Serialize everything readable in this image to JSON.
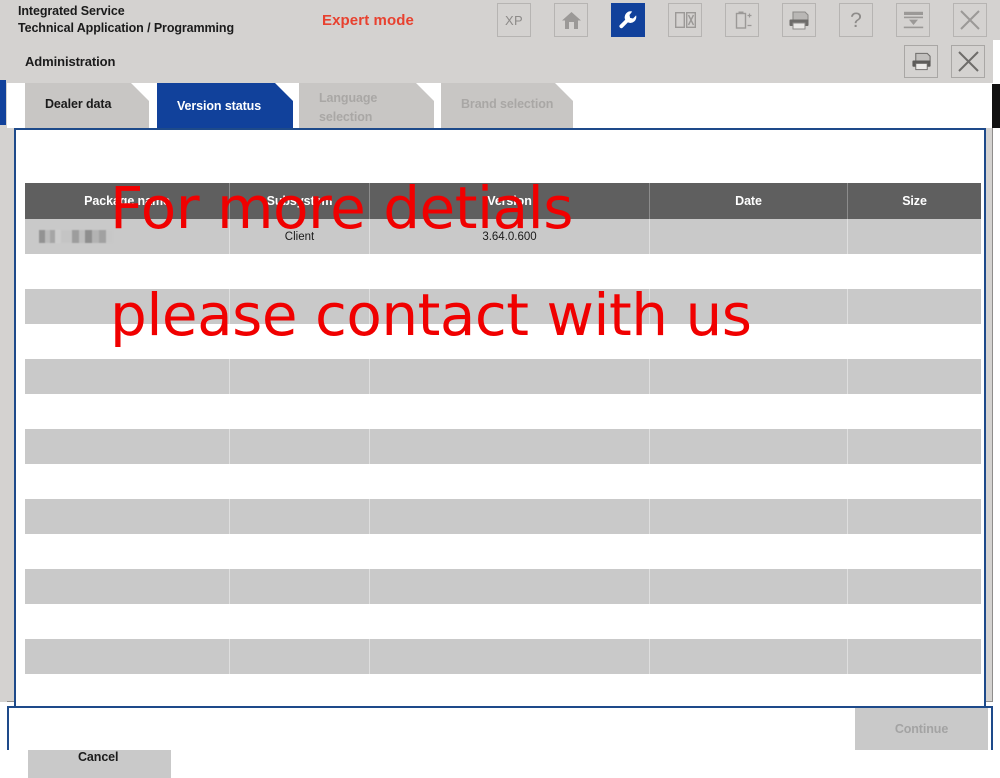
{
  "app": {
    "title": "Integrated Service\nTechnical Application / Programming",
    "mode_badge": "Expert mode",
    "toolbar": [
      {
        "name": "xp-button",
        "label": "XP",
        "icon": "xp-text-icon",
        "active": false
      },
      {
        "name": "home-button",
        "label": "",
        "icon": "home-icon",
        "active": false
      },
      {
        "name": "tools-button",
        "label": "",
        "icon": "wrench-icon",
        "active": true
      },
      {
        "name": "vehicle-id-button",
        "label": "",
        "icon": "id-card-icon",
        "active": false
      },
      {
        "name": "battery-button",
        "label": "",
        "icon": "battery-icon",
        "active": false
      },
      {
        "name": "print-button",
        "label": "",
        "icon": "printer-icon",
        "active": false
      },
      {
        "name": "help-button",
        "label": "?",
        "icon": "question-mark-icon",
        "active": false
      },
      {
        "name": "minimize-button",
        "label": "",
        "icon": "tray-down-icon",
        "active": false
      },
      {
        "name": "close-button",
        "label": "",
        "icon": "close-x-icon",
        "active": false
      }
    ]
  },
  "dialog": {
    "title": "Administration",
    "print_icon": "printer-icon",
    "close_icon": "close-x-icon"
  },
  "tabs": [
    {
      "label": "Dealer data",
      "state": "normal"
    },
    {
      "label": "Version status",
      "state": "selected"
    },
    {
      "label": "Language\nselection",
      "state": "disabled"
    },
    {
      "label": "Brand selection",
      "state": "disabled"
    }
  ],
  "table": {
    "columns": [
      "Package name",
      "Subsystem",
      "Version",
      "Date",
      "Size"
    ],
    "rows": [
      {
        "package_name": "",
        "package_redacted": true,
        "subsystem": "Client",
        "version": "3.64.0.600",
        "date": "",
        "size": ""
      },
      {
        "package_name": "",
        "package_redacted": false,
        "subsystem": "",
        "version": "",
        "date": "",
        "size": ""
      },
      {
        "package_name": "",
        "package_redacted": false,
        "subsystem": "",
        "version": "",
        "date": "",
        "size": ""
      },
      {
        "package_name": "",
        "package_redacted": false,
        "subsystem": "",
        "version": "",
        "date": "",
        "size": ""
      },
      {
        "package_name": "",
        "package_redacted": false,
        "subsystem": "",
        "version": "",
        "date": "",
        "size": ""
      },
      {
        "package_name": "",
        "package_redacted": false,
        "subsystem": "",
        "version": "",
        "date": "",
        "size": ""
      },
      {
        "package_name": "",
        "package_redacted": false,
        "subsystem": "",
        "version": "",
        "date": "",
        "size": ""
      },
      {
        "package_name": "",
        "package_redacted": false,
        "subsystem": "",
        "version": "",
        "date": "",
        "size": ""
      }
    ]
  },
  "buttons": {
    "cancel_label": "Cancel",
    "continue_label": "Continue"
  },
  "watermark": {
    "line1": "For more detials",
    "line2": "please contact with us",
    "color": "#f00000"
  },
  "colors": {
    "accent_blue": "#11419b",
    "panel_border": "#1e4a8a",
    "chrome_gray": "#d4d2d0",
    "header_gray": "#5f5f5f",
    "row_gray": "#c9c9c9",
    "expert_red": "#e8412f"
  }
}
